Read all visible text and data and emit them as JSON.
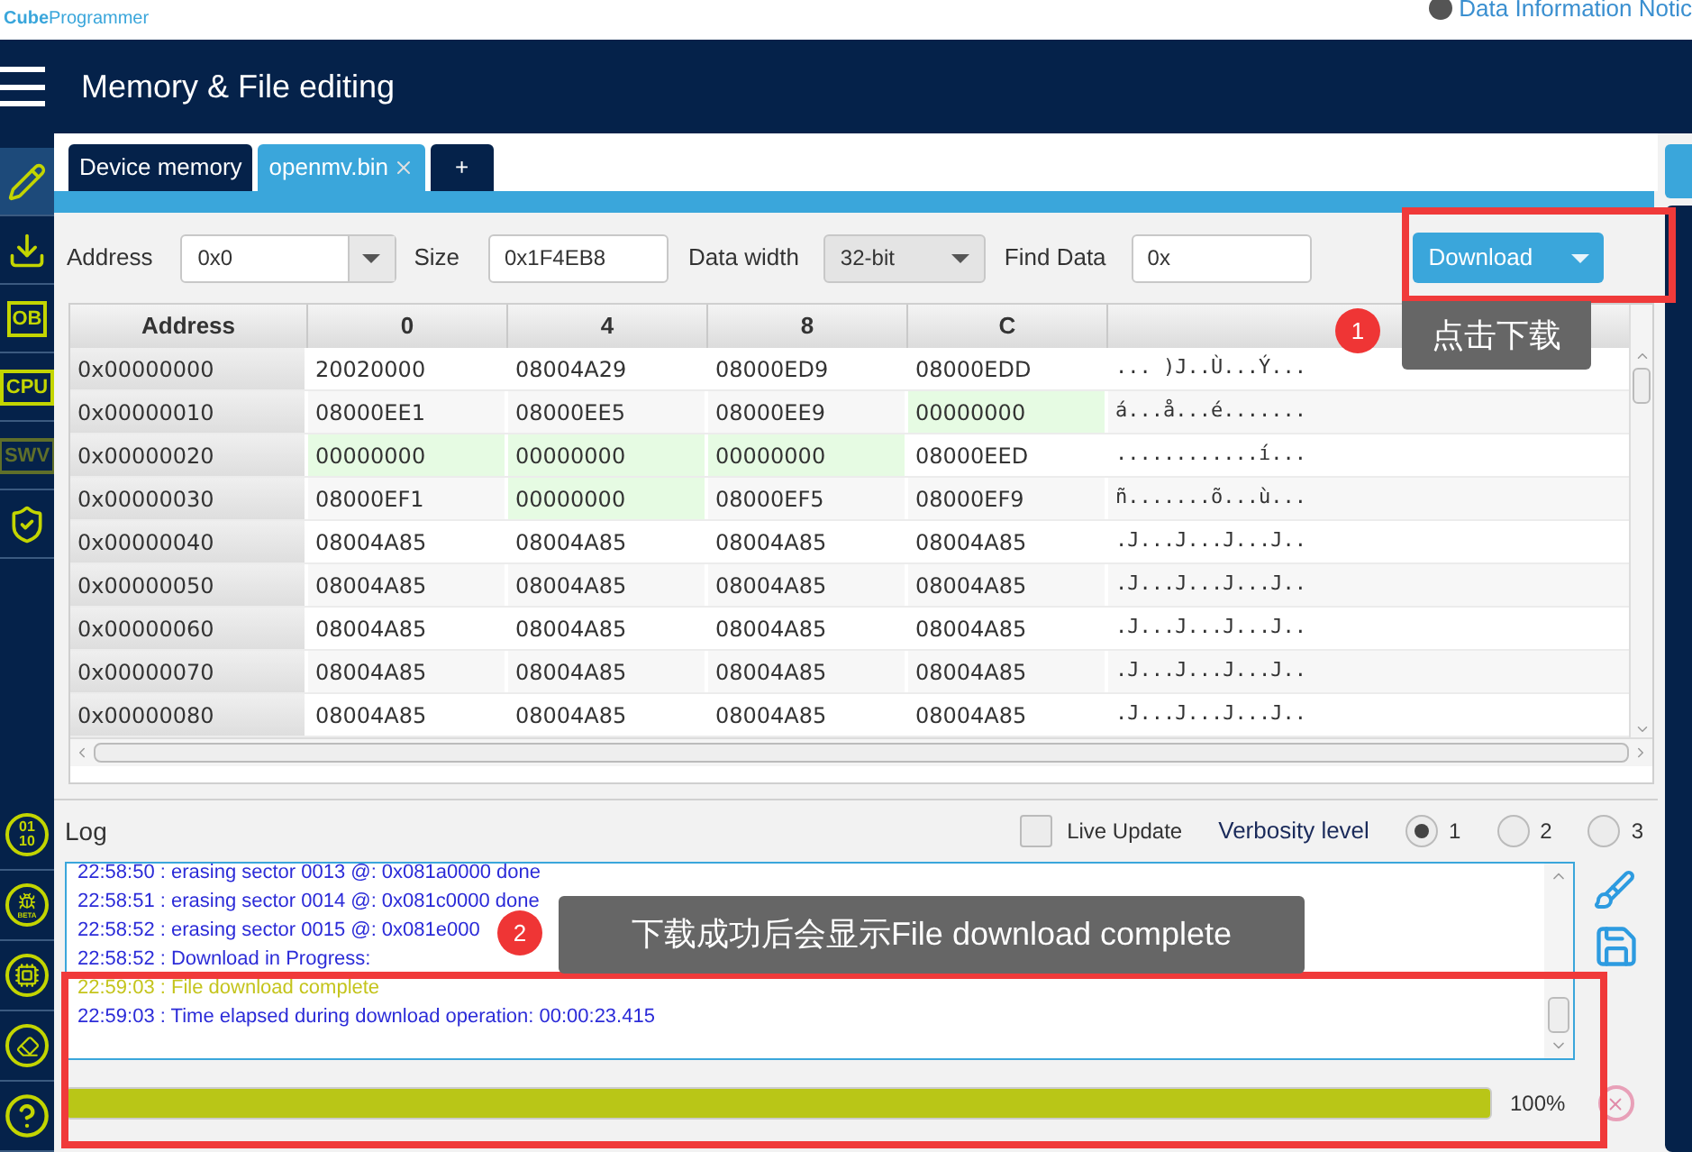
{
  "top_bar": {
    "logo_brand": "Cube",
    "logo_product": "Programmer",
    "notice_link": "Data Information Notic"
  },
  "header": {
    "title": "Memory & File editing"
  },
  "sidebar": {
    "top": [
      {
        "kind": "pencil",
        "selected": true
      },
      {
        "kind": "download",
        "selected": false
      },
      {
        "kind": "text",
        "label": "OB",
        "selected": false,
        "disabled": false
      },
      {
        "kind": "text",
        "label": "CPU",
        "selected": false,
        "disabled": false
      },
      {
        "kind": "text",
        "label": "SWV",
        "selected": false,
        "disabled": true
      },
      {
        "kind": "shield",
        "selected": false
      }
    ],
    "bottom": [
      {
        "kind": "binary",
        "lines": [
          "01",
          "10"
        ]
      },
      {
        "kind": "bug",
        "label": "BETA"
      },
      {
        "kind": "chip"
      },
      {
        "kind": "eraser"
      },
      {
        "kind": "help"
      }
    ]
  },
  "tabs": [
    {
      "label": "Device memory",
      "selected": false,
      "closable": false
    },
    {
      "label": "openmv.bin",
      "selected": true,
      "closable": true
    },
    {
      "label": "+",
      "selected": false,
      "closable": false
    }
  ],
  "toolbar": {
    "address_label": "Address",
    "address_value": "0x0",
    "size_label": "Size",
    "size_value": "0x1F4EB8",
    "data_width_label": "Data width",
    "data_width_value": "32-bit",
    "find_label": "Find Data",
    "find_value": "0x",
    "download_button": "Download"
  },
  "table": {
    "columns": [
      "Address",
      "0",
      "4",
      "8",
      "C"
    ],
    "rows": [
      {
        "cells": [
          {
            "text": "0x00000000",
            "kind": "address"
          },
          {
            "text": "20020000",
            "highlighted": false
          },
          {
            "text": "08004A29",
            "highlighted": false
          },
          {
            "text": "08000ED9",
            "highlighted": false
          },
          {
            "text": "08000EDD",
            "highlighted": false
          }
        ],
        "ascii": "... )J..Ù...Ý..."
      },
      {
        "cells": [
          {
            "text": "0x00000010",
            "kind": "address"
          },
          {
            "text": "08000EE1",
            "highlighted": false
          },
          {
            "text": "08000EE5",
            "highlighted": false
          },
          {
            "text": "08000EE9",
            "highlighted": false
          },
          {
            "text": "00000000",
            "highlighted": true
          }
        ],
        "ascii": "á...å...é......."
      },
      {
        "cells": [
          {
            "text": "0x00000020",
            "kind": "address"
          },
          {
            "text": "00000000",
            "highlighted": true
          },
          {
            "text": "00000000",
            "highlighted": true
          },
          {
            "text": "00000000",
            "highlighted": true
          },
          {
            "text": "08000EED",
            "highlighted": false
          }
        ],
        "ascii": "............í..."
      },
      {
        "cells": [
          {
            "text": "0x00000030",
            "kind": "address"
          },
          {
            "text": "08000EF1",
            "highlighted": false
          },
          {
            "text": "00000000",
            "highlighted": true
          },
          {
            "text": "08000EF5",
            "highlighted": false
          },
          {
            "text": "08000EF9",
            "highlighted": false
          }
        ],
        "ascii": "ñ.......õ...ù..."
      },
      {
        "cells": [
          {
            "text": "0x00000040",
            "kind": "address"
          },
          {
            "text": "08004A85",
            "highlighted": false
          },
          {
            "text": "08004A85",
            "highlighted": false
          },
          {
            "text": "08004A85",
            "highlighted": false
          },
          {
            "text": "08004A85",
            "highlighted": false
          }
        ],
        "ascii": ".J...J...J...J.."
      },
      {
        "cells": [
          {
            "text": "0x00000050",
            "kind": "address"
          },
          {
            "text": "08004A85",
            "highlighted": false
          },
          {
            "text": "08004A85",
            "highlighted": false
          },
          {
            "text": "08004A85",
            "highlighted": false
          },
          {
            "text": "08004A85",
            "highlighted": false
          }
        ],
        "ascii": ".J...J...J...J.."
      },
      {
        "cells": [
          {
            "text": "0x00000060",
            "kind": "address"
          },
          {
            "text": "08004A85",
            "highlighted": false
          },
          {
            "text": "08004A85",
            "highlighted": false
          },
          {
            "text": "08004A85",
            "highlighted": false
          },
          {
            "text": "08004A85",
            "highlighted": false
          }
        ],
        "ascii": ".J...J...J...J.."
      },
      {
        "cells": [
          {
            "text": "0x00000070",
            "kind": "address"
          },
          {
            "text": "08004A85",
            "highlighted": false
          },
          {
            "text": "08004A85",
            "highlighted": false
          },
          {
            "text": "08004A85",
            "highlighted": false
          },
          {
            "text": "08004A85",
            "highlighted": false
          }
        ],
        "ascii": ".J...J...J...J.."
      },
      {
        "cells": [
          {
            "text": "0x00000080",
            "kind": "address"
          },
          {
            "text": "08004A85",
            "highlighted": false
          },
          {
            "text": "08004A85",
            "highlighted": false
          },
          {
            "text": "08004A85",
            "highlighted": false
          },
          {
            "text": "08004A85",
            "highlighted": false
          }
        ],
        "ascii": ".J...J...J...J.."
      }
    ]
  },
  "log": {
    "title": "Log",
    "live_update": {
      "label": "Live Update",
      "checked": false
    },
    "verbosity_label": "Verbosity level",
    "verbosity": [
      {
        "label": "1",
        "selected": true
      },
      {
        "label": "2",
        "selected": false
      },
      {
        "label": "3",
        "selected": false
      }
    ],
    "lines": [
      {
        "text": "22:58:50 : erasing sector 0013 @: 0x081a0000 done",
        "kind": "info"
      },
      {
        "text": "22:58:51 : erasing sector 0014 @: 0x081c0000 done",
        "kind": "info"
      },
      {
        "text": "22:58:52 : erasing sector 0015 @: 0x081e000",
        "kind": "info"
      },
      {
        "text": "22:58:52 : Download in Progress:",
        "kind": "info"
      },
      {
        "text": "22:59:03 : File download complete",
        "kind": "success"
      },
      {
        "text": "22:59:03 : Time elapsed during download operation: 00:00:23.415",
        "kind": "info"
      }
    ],
    "progress": {
      "level": 1,
      "reading": "100%"
    }
  },
  "annotations": [
    {
      "number": "1",
      "text": "点击下载"
    },
    {
      "number": "2",
      "text": "下载成功后会显示File download complete"
    }
  ]
}
